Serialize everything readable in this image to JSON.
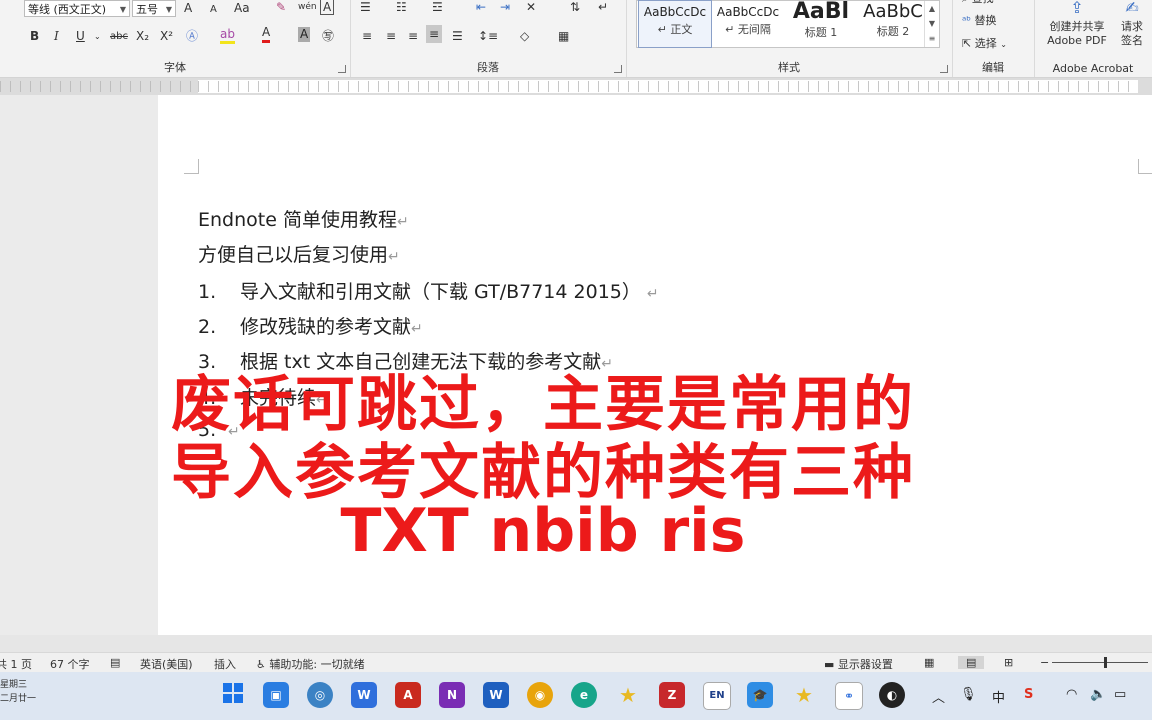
{
  "ribbon": {
    "font_group": {
      "label": "字体",
      "font_name": "等线 (西文正文)",
      "font_size": "五号",
      "grow_font": "A",
      "shrink_font": "A",
      "change_case": "Aa",
      "phonetic_guide": "wén",
      "char_border": "A",
      "bold": "B",
      "italic": "I",
      "underline": "U",
      "strikethrough": "abc",
      "subscript": "X₂",
      "superscript": "X²",
      "font_color": "A",
      "char_shading": "A"
    },
    "paragraph_group": {
      "label": "段落"
    },
    "styles_group": {
      "label": "样式",
      "items": [
        {
          "sample": "AaBbCcDc",
          "name": "↵ 正文"
        },
        {
          "sample": "AaBbCcDc",
          "name": "↵ 无间隔"
        },
        {
          "sample": "AaBl",
          "name": "标题 1"
        },
        {
          "sample": "AaBbC",
          "name": "标题 2"
        }
      ]
    },
    "edit_group": {
      "label": "编辑",
      "find": "查找",
      "replace": "替换",
      "select": "选择"
    },
    "acrobat_group": {
      "label": "Adobe Acrobat",
      "create_share_line1": "创建并共享",
      "create_share_line2": "Adobe PDF",
      "request_sign_line1": "请求",
      "request_sign_line2": "签名"
    }
  },
  "document": {
    "lines": [
      "Endnote 简单使用教程",
      "方便自己以后复习使用"
    ],
    "list": [
      {
        "num": "1.",
        "text": "导入文献和引用文献（下载 GT/B7714 2015）"
      },
      {
        "num": "2.",
        "text": "修改残缺的参考文献"
      },
      {
        "num": "3.",
        "text": "根据 txt 文本自己创建无法下载的参考文献"
      },
      {
        "num": "4.",
        "text": "未完待续"
      },
      {
        "num": "5.",
        "text": ""
      }
    ],
    "para_mark": "↵"
  },
  "overlay": {
    "line1": "废话可跳过，主要是常用的",
    "line2": "导入参考文献的种类有三种",
    "line3": "TXT nbib ris",
    "color": "#ec1a1a"
  },
  "statusbar": {
    "page": "共 1 页",
    "words": "67 个字",
    "language": "英语(美国)",
    "mode": "插入",
    "accessibility": "辅助功能: 一切就绪",
    "display_settings": "显示器设置"
  },
  "taskbar": {
    "clock_line1": "星期三",
    "clock_line2": "二月廿一",
    "tray_ime": "中",
    "tray_lang": "EN"
  }
}
